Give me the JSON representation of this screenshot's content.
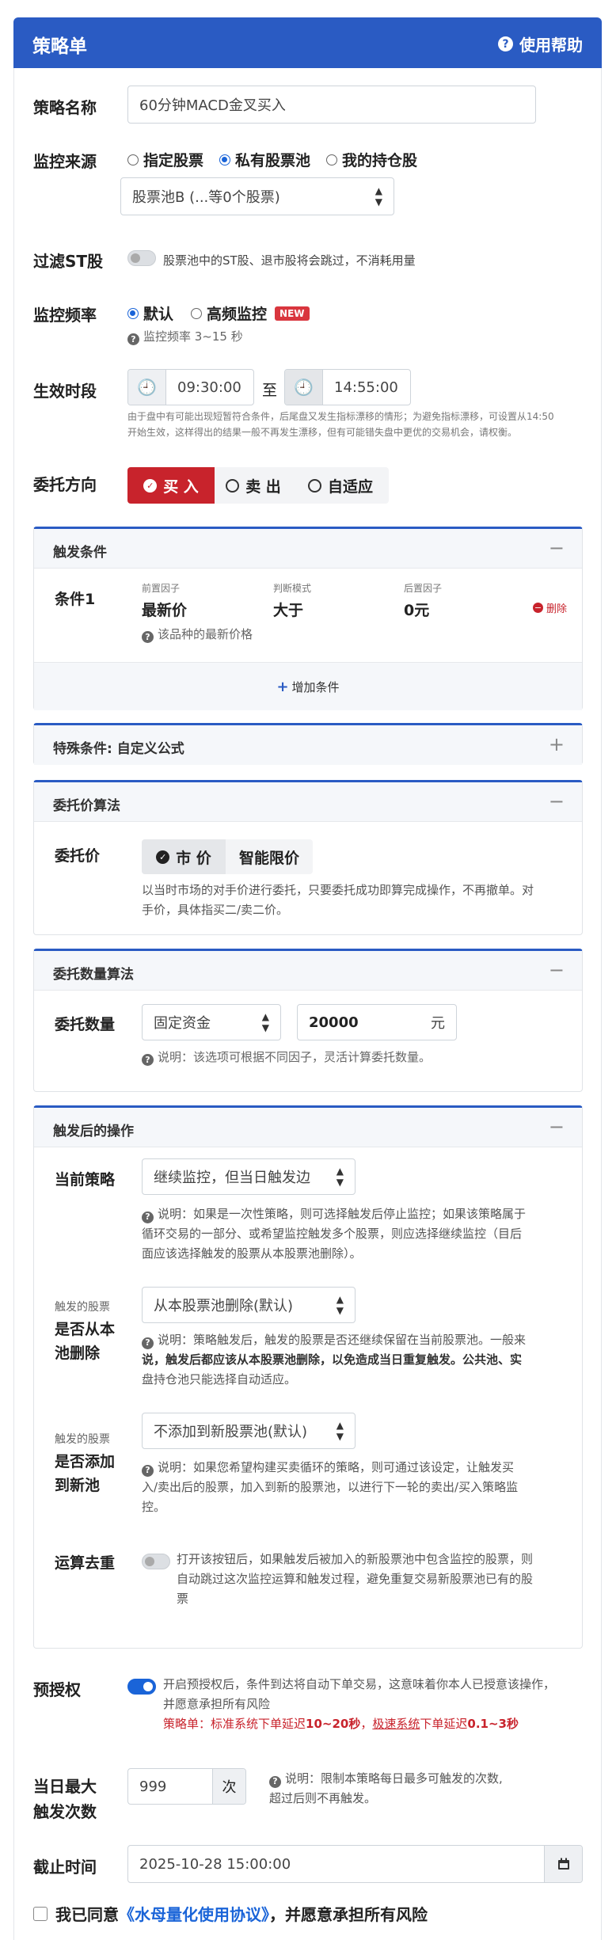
{
  "header": {
    "title": "策略单",
    "help": "使用帮助"
  },
  "strategy_name": {
    "label": "策略名称",
    "value": "60分钟MACD金叉买入"
  },
  "monitor_source": {
    "label": "监控来源",
    "options": [
      "指定股票",
      "私有股票池",
      "我的持仓股"
    ],
    "selected": "私有股票池",
    "pool_select": "股票池B (...等0个股票)"
  },
  "filter_st": {
    "label": "过滤ST股",
    "text": "股票池中的ST股、退市股将会跳过，不消耗用量"
  },
  "monitor_freq": {
    "label": "监控频率",
    "options": [
      "默认",
      "高频监控"
    ],
    "selected": "默认",
    "new_badge": "NEW",
    "hint": "监控频率 3~15 秒"
  },
  "active_time": {
    "label": "生效时段",
    "start": "09:30:00",
    "to": "至",
    "end": "14:55:00",
    "note_line1": "由于盘中有可能出现短暂符合条件，后尾盘又发生指标漂移的情形；为避免指标漂移，可设置从14:50",
    "note_line2": "开始生效，这样得出的结果一般不再发生漂移，但有可能错失盘中更优的交易机会，请权衡。"
  },
  "direction": {
    "label": "委托方向",
    "buy": "买 入",
    "sell": "卖 出",
    "adaptive": "自适应"
  },
  "trigger": {
    "title": "触发条件",
    "cond_label": "条件1",
    "pre_factor_label": "前置因子",
    "pre_factor": "最新价",
    "judge_label": "判断模式",
    "judge": "大于",
    "post_factor_label": "后置因子",
    "post_factor": "0元",
    "delete": "删除",
    "hint": "该品种的最新价格",
    "add": "增加条件"
  },
  "special": {
    "title": "特殊条件: 自定义公式"
  },
  "price_algo": {
    "title": "委托价算法",
    "label": "委托价",
    "market": "市 价",
    "smart": "智能限价",
    "desc_line1": "以当时市场的对手价进行委托，只要委托成功即算完成操作，不再撤单。对",
    "desc_line2": "手价，具体指买二/卖二价。"
  },
  "qty_algo": {
    "title": "委托数量算法",
    "label": "委托数量",
    "mode": "固定资金",
    "amount": "20000",
    "unit": "元",
    "hint": "说明：该选项可根据不同因子，灵活计算委托数量。"
  },
  "after": {
    "title": "触发后的操作",
    "current_label": "当前策略",
    "current_value": "继续监控，但当日触发边",
    "current_note": [
      "说明：如果是一次性策略，则可选择触发后停止监控；如果该策略属于",
      "循环交易的一部分、或希望监控触发多个股票，则应选择继续监控（目后",
      "面应该选择触发的股票从本股票池删除）。"
    ],
    "remove_small": "触发的股票",
    "remove_label_1": "是否从本",
    "remove_label_2": "池删除",
    "remove_value": "从本股票池删除(默认)",
    "remove_note": [
      "说明：策略触发后，触发的股票是否还继续保留在当前股票池。一般来",
      "说，触发后都应该从本股票池删除，以免造成当日重复触发。公共池、实",
      "盘持仓池只能选择自动适应。"
    ],
    "add_small": "触发的股票",
    "add_label_1": "是否添加",
    "add_label_2": "到新池",
    "add_value": "不添加到新股票池(默认)",
    "add_note": [
      "说明：如果您希望构建买卖循环的策略，则可通过该设定，让触发买",
      "入/卖出后的股票，加入到新的股票池，以进行下一轮的卖出/买入策略监",
      "控。"
    ],
    "dedup_label": "运算去重",
    "dedup_note": [
      "打开该按钮后，如果触发后被加入的新股票池中包含监控的股票，则",
      "自动跳过这次监控运算和触发过程，避免重复交易新股票池已有的股",
      "票"
    ]
  },
  "preauth": {
    "label": "预授权",
    "line1": "开启预授权后，条件到达将自动下单交易，这意味着你本人已授意该操作，",
    "line2": "并愿意承担所有风险",
    "line3_a": "策略单：标准系统下单延迟",
    "line3_b": "10~20秒",
    "line3_c": "，",
    "line3_d": "极速系统",
    "line3_e": "下单延迟",
    "line3_f": "0.1~3秒"
  },
  "daily_max": {
    "label_1": "当日最大",
    "label_2": "触发次数",
    "value": "999",
    "unit": "次",
    "note_1": "说明：限制本策略每日最多可触发的次数,",
    "note_2": "超过后则不再触发。"
  },
  "deadline": {
    "label": "截止时间",
    "value": "2025-10-28 15:00:00"
  },
  "agree": {
    "a": "我已同意",
    "link": "《水母量化使用协议》",
    "b": "，并愿意承担所有风险"
  },
  "colors": {
    "primary": "#2a5bc3",
    "buy_red": "#c8232c",
    "link_blue": "#1a64d8"
  }
}
